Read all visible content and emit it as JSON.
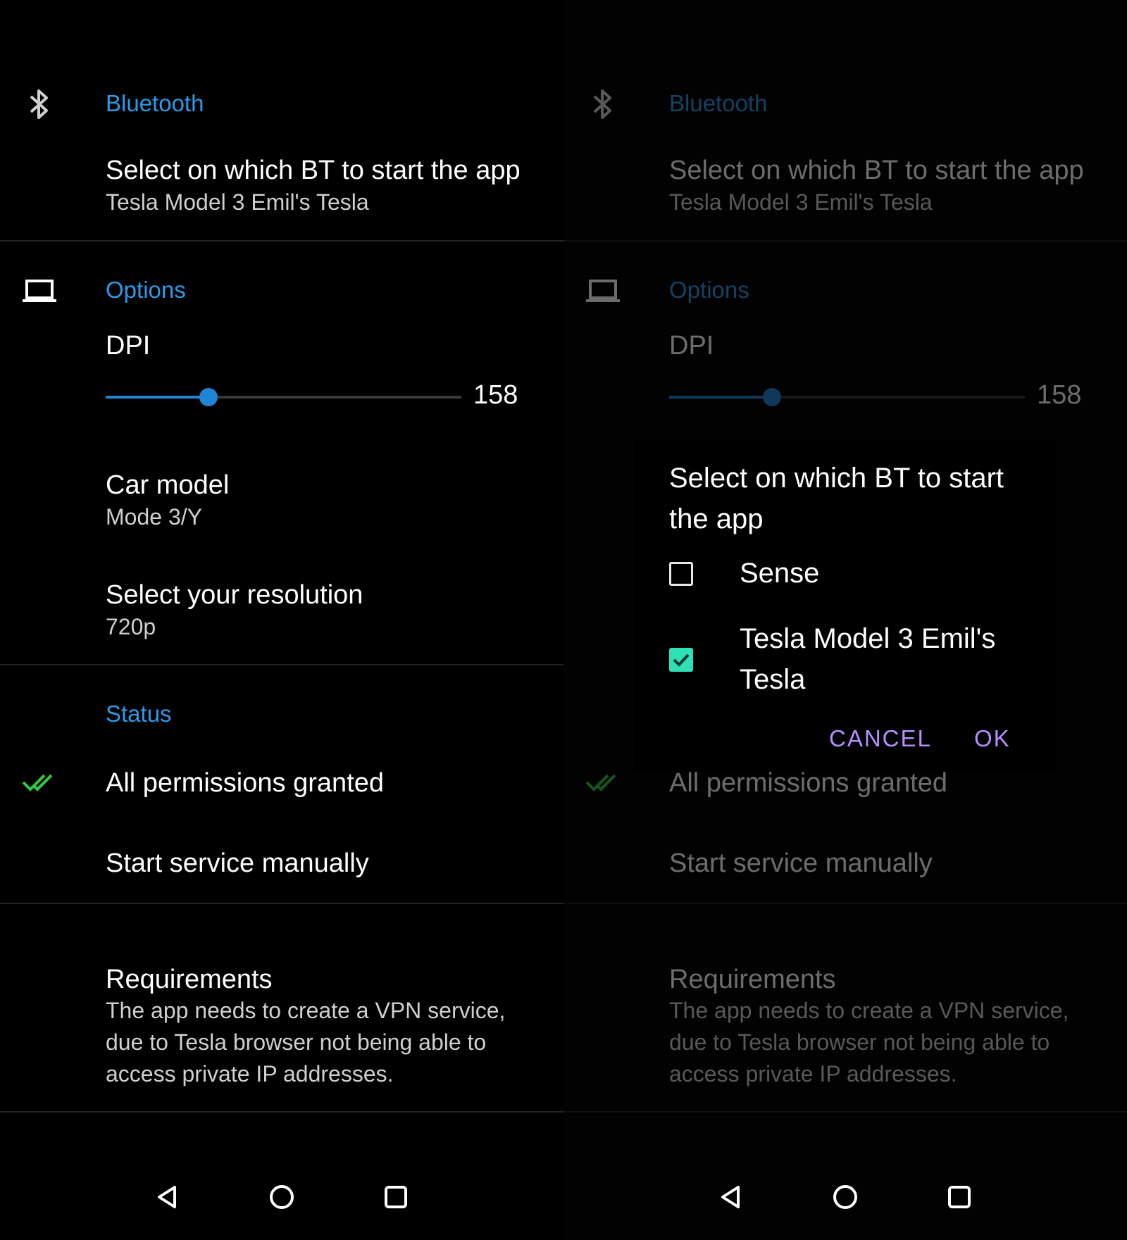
{
  "colors": {
    "accent": "#2b9be8",
    "slider": "#1f86d6",
    "check_green": "#2ecc40",
    "dialog_button": "#b98cff",
    "checkbox_on": "#2fe0b5"
  },
  "panels": {
    "left": {
      "bluetooth": {
        "section_title": "Bluetooth",
        "pref_title": "Select on which BT to start the app",
        "pref_value": "Tesla Model 3 Emil's Tesla"
      },
      "options": {
        "section_title": "Options",
        "dpi_label": "DPI",
        "dpi_value": "158",
        "dpi_fraction": 0.29,
        "car_model_title": "Car model",
        "car_model_value": "Mode 3/Y",
        "resolution_title": "Select your resolution",
        "resolution_value": "720p"
      },
      "status": {
        "section_title": "Status",
        "permissions": "All permissions granted",
        "start_service": "Start service manually"
      },
      "requirements": {
        "title": "Requirements",
        "description": "The app needs to create a VPN service, due to Tesla browser not being able to access private IP addresses."
      }
    },
    "right": {
      "bluetooth": {
        "section_title": "Bluetooth",
        "pref_title": "Select on which BT to start the app",
        "pref_value": "Tesla Model 3 Emil's Tesla"
      },
      "options": {
        "section_title": "Options",
        "dpi_label": "DPI",
        "dpi_value": "158",
        "dpi_fraction": 0.29
      },
      "status": {
        "permissions": "All permissions granted",
        "start_service": "Start service manually"
      },
      "requirements": {
        "title": "Requirements",
        "description": "The app needs to create a VPN service, due to Tesla browser not being able to access private IP addresses."
      }
    }
  },
  "dialog": {
    "title": "Select on which BT to start the app",
    "options": [
      {
        "label": "Sense",
        "checked": false
      },
      {
        "label": "Tesla Model 3 Emil's Tesla",
        "checked": true
      }
    ],
    "cancel_label": "CANCEL",
    "ok_label": "OK"
  },
  "icons": {
    "bluetooth": "bluetooth-icon",
    "options": "laptop-icon",
    "status": "double-check-icon",
    "nav_back": "back-triangle-icon",
    "nav_home": "home-circle-icon",
    "nav_recents": "recents-square-icon"
  }
}
